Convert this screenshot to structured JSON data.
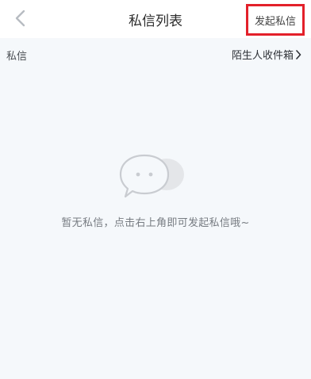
{
  "header": {
    "title": "私信列表",
    "compose_label": "发起私信",
    "accent_color": "#e3202a"
  },
  "section": {
    "label": "私信",
    "stranger_inbox_label": "陌生人收件箱"
  },
  "empty_state": {
    "message": "暂无私信，点击右上角即可发起私信哦~"
  },
  "icons": {
    "back": "chevron-left-icon",
    "stranger_arrow": "chevron-right-icon",
    "empty": "chat-bubble-icon"
  }
}
